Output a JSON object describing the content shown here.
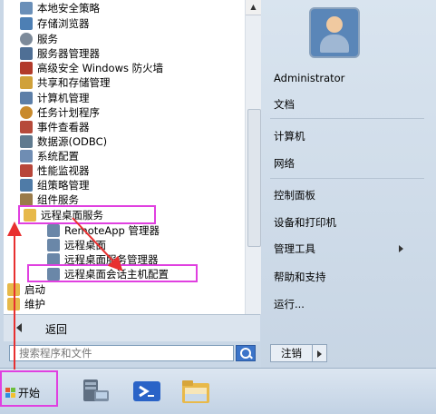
{
  "programs": [
    {
      "label": "本地安全策略",
      "icon": "security-policy-icon",
      "color": "#6a8fb8"
    },
    {
      "label": "存储浏览器",
      "icon": "storage-icon",
      "color": "#4d7fb4"
    },
    {
      "label": "服务",
      "icon": "gear-icon",
      "color": "#7d8a99"
    },
    {
      "label": "服务器管理器",
      "icon": "server-icon",
      "color": "#4f6f95"
    },
    {
      "label": "高级安全 Windows 防火墙",
      "icon": "firewall-icon",
      "color": "#b23a2a"
    },
    {
      "label": "共享和存储管理",
      "icon": "share-icon",
      "color": "#d0a13a"
    },
    {
      "label": "计算机管理",
      "icon": "computer-icon",
      "color": "#5d7fa8"
    },
    {
      "label": "任务计划程序",
      "icon": "clock-icon",
      "color": "#c98a2c"
    },
    {
      "label": "事件查看器",
      "icon": "event-viewer-icon",
      "color": "#b64a3a"
    },
    {
      "label": "数据源(ODBC)",
      "icon": "database-icon",
      "color": "#5f7a8f"
    },
    {
      "label": "系统配置",
      "icon": "system-config-icon",
      "color": "#6f8db3"
    },
    {
      "label": "性能监视器",
      "icon": "monitor-icon",
      "color": "#b8463a"
    },
    {
      "label": "组策略管理",
      "icon": "group-policy-icon",
      "color": "#4f7ba7"
    },
    {
      "label": "组件服务",
      "icon": "component-icon",
      "color": "#9a7b4a"
    },
    {
      "label": "远程桌面服务",
      "icon": "folder-icon",
      "color": "#e7b94a"
    },
    {
      "label": "RemoteApp 管理器",
      "icon": "remoteapp-icon",
      "color": "#6a87a8"
    },
    {
      "label": "远程桌面",
      "icon": "remote-desktop-icon",
      "color": "#6a87a8"
    },
    {
      "label": "远程桌面服务管理器",
      "icon": "rds-manager-icon",
      "color": "#6a87a8"
    },
    {
      "label": "远程桌面会话主机配置",
      "icon": "session-host-icon",
      "color": "#6a87a8"
    },
    {
      "label": "启动",
      "icon": "folder-icon",
      "color": "#e7b94a"
    },
    {
      "label": "维护",
      "icon": "folder-icon",
      "color": "#e7b94a"
    }
  ],
  "back_label": "返回",
  "search": {
    "placeholder": "搜索程序和文件"
  },
  "right_menu": {
    "user": "Administrator",
    "documents": "文档",
    "computer": "计算机",
    "network": "网络",
    "control_panel": "控制面板",
    "devices_printers": "设备和打印机",
    "admin_tools": "管理工具",
    "help_support": "帮助和支持",
    "run": "运行..."
  },
  "shutdown_label": "注销",
  "taskbar": {
    "start_label": "开始"
  },
  "colors": {
    "annotation": "#e040e0",
    "arrow": "#e83030",
    "taskbar_accent": "#3b74c9"
  }
}
